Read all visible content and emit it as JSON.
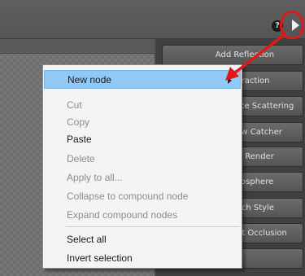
{
  "panel": {
    "buttons": [
      "Add Reflection",
      "Refraction",
      "Subsurface Scattering",
      "Shadow Catcher",
      "Toon Render",
      "Atmosphere",
      "Sketch Style",
      "Ambient Occlusion"
    ]
  },
  "menu": {
    "new_node": "New node",
    "cut": "Cut",
    "copy": "Copy",
    "paste": "Paste",
    "delete": "Delete",
    "apply_to_all": "Apply to all...",
    "collapse": "Collapse to compound node",
    "expand": "Expand compound nodes",
    "select_all": "Select all",
    "invert_selection": "Invert selection"
  },
  "toolbar": {
    "help_glyph": "?"
  },
  "colors": {
    "annotation": "#e01818",
    "highlight": "#90c8f6"
  }
}
